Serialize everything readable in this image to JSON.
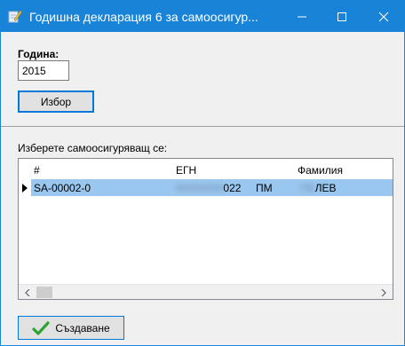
{
  "window": {
    "title": "Годишна декларация 6 за самоосигур..."
  },
  "form": {
    "year_label": "Година:",
    "year_value": "2015",
    "select_button": "Избор",
    "choose_label": "Изберете самоосигуряващ се:"
  },
  "grid": {
    "columns": [
      "#",
      "ЕГН",
      "Фамилия"
    ],
    "rows": [
      {
        "id": "SA-00002-0",
        "egn_hidden": "00000000",
        "egn_suffix": "022",
        "initials": "ПМ",
        "surname_hidden": "ПЕ",
        "surname_suffix": "ЛЕВ"
      }
    ]
  },
  "footer": {
    "create_button": "Създаване"
  },
  "colors": {
    "titlebar": "#1883d7",
    "selection": "#99c7ef",
    "button_focus": "#0078d7",
    "check_icon": "#2ea334"
  }
}
